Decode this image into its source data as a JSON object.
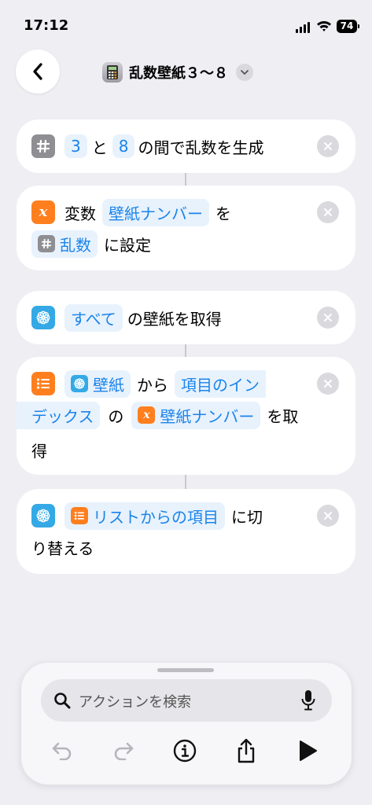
{
  "status": {
    "time": "17:12",
    "battery": "74"
  },
  "nav": {
    "title": "乱数壁紙３〜８",
    "app_icon": "calculator-icon"
  },
  "actions": {
    "random": {
      "min": "3",
      "conj": "と",
      "max": "8",
      "suffix": "の間で乱数を生成"
    },
    "setvar": {
      "label": "変数",
      "var": "壁紙ナンバー",
      "particle": "を",
      "value": "乱数",
      "suffix": "に設定"
    },
    "getall": {
      "scope": "すべて",
      "suffix": "の壁紙を取得"
    },
    "getitem": {
      "source": "壁紙",
      "from": "から",
      "item_a": "項目のイン",
      "item_b": "デックス",
      "no": "の",
      "var": "壁紙ナンバー",
      "suffix_a": "を取",
      "suffix_b": "得"
    },
    "switch": {
      "source": "リストからの項目",
      "suffix_a": "に切",
      "suffix_b": "り替える"
    }
  },
  "sheet": {
    "search_placeholder": "アクションを検索"
  },
  "colors": {
    "accent": "#1a84ea",
    "orange": "#ff7f1f",
    "cyan": "#34a9e6",
    "gray": "#8e8e93"
  }
}
